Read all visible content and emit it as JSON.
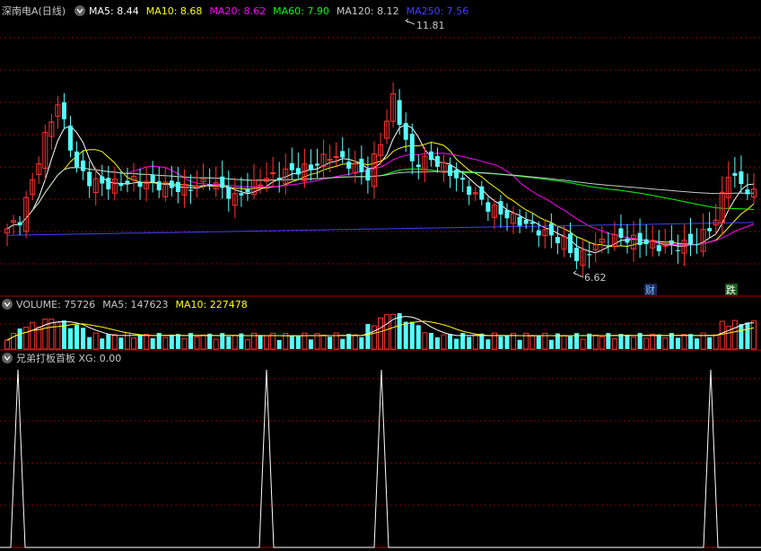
{
  "header": {
    "title": "深南电A(日线)",
    "ma": [
      {
        "label": "MA5: 8.44",
        "color": "#ffffff"
      },
      {
        "label": "MA10: 8.68",
        "color": "#ffff00"
      },
      {
        "label": "MA20: 8.62",
        "color": "#ff00ff"
      },
      {
        "label": "MA60: 7.90",
        "color": "#00ff00"
      },
      {
        "label": "MA120: 8.12",
        "color": "#c8c8c8"
      },
      {
        "label": "MA250: 7.56",
        "color": "#4040ff"
      }
    ]
  },
  "volume_header": {
    "items": [
      {
        "label": "VOLUME: 75726",
        "color": "#c8c8c8"
      },
      {
        "label": "MA5: 147623",
        "color": "#c8c8c8"
      },
      {
        "label": "MA10: 227478",
        "color": "#ffff00"
      }
    ]
  },
  "indicator_header": {
    "label": "兄弟打板首板  XG: 0.00",
    "color": "#c8c8c8"
  },
  "annotations": {
    "high": "11.81",
    "low": "6.62",
    "badge1": "财",
    "badge2": "跌"
  },
  "colors": {
    "up": "#ff3232",
    "down": "#54ffff",
    "grid": "#8b0000",
    "axis": "#b00000"
  },
  "chart_data": [
    {
      "type": "candlestick",
      "title": "深南电A(日线)",
      "annotations": [
        {
          "label": "11.81",
          "kind": "high"
        },
        {
          "label": "6.62",
          "kind": "low"
        }
      ],
      "series": [
        {
          "name": "MA5",
          "value": 8.44
        },
        {
          "name": "MA10",
          "value": 8.68
        },
        {
          "name": "MA20",
          "value": 8.62
        },
        {
          "name": "MA60",
          "value": 7.9
        },
        {
          "name": "MA120",
          "value": 8.12
        },
        {
          "name": "MA250",
          "value": 7.56
        }
      ]
    },
    {
      "type": "bar",
      "series": [
        {
          "name": "VOLUME",
          "value": 75726
        },
        {
          "name": "MA5",
          "value": 147623
        },
        {
          "name": "MA10",
          "value": 227478
        }
      ]
    },
    {
      "type": "line",
      "series": [
        {
          "name": "XG",
          "value": 0.0
        }
      ]
    }
  ]
}
